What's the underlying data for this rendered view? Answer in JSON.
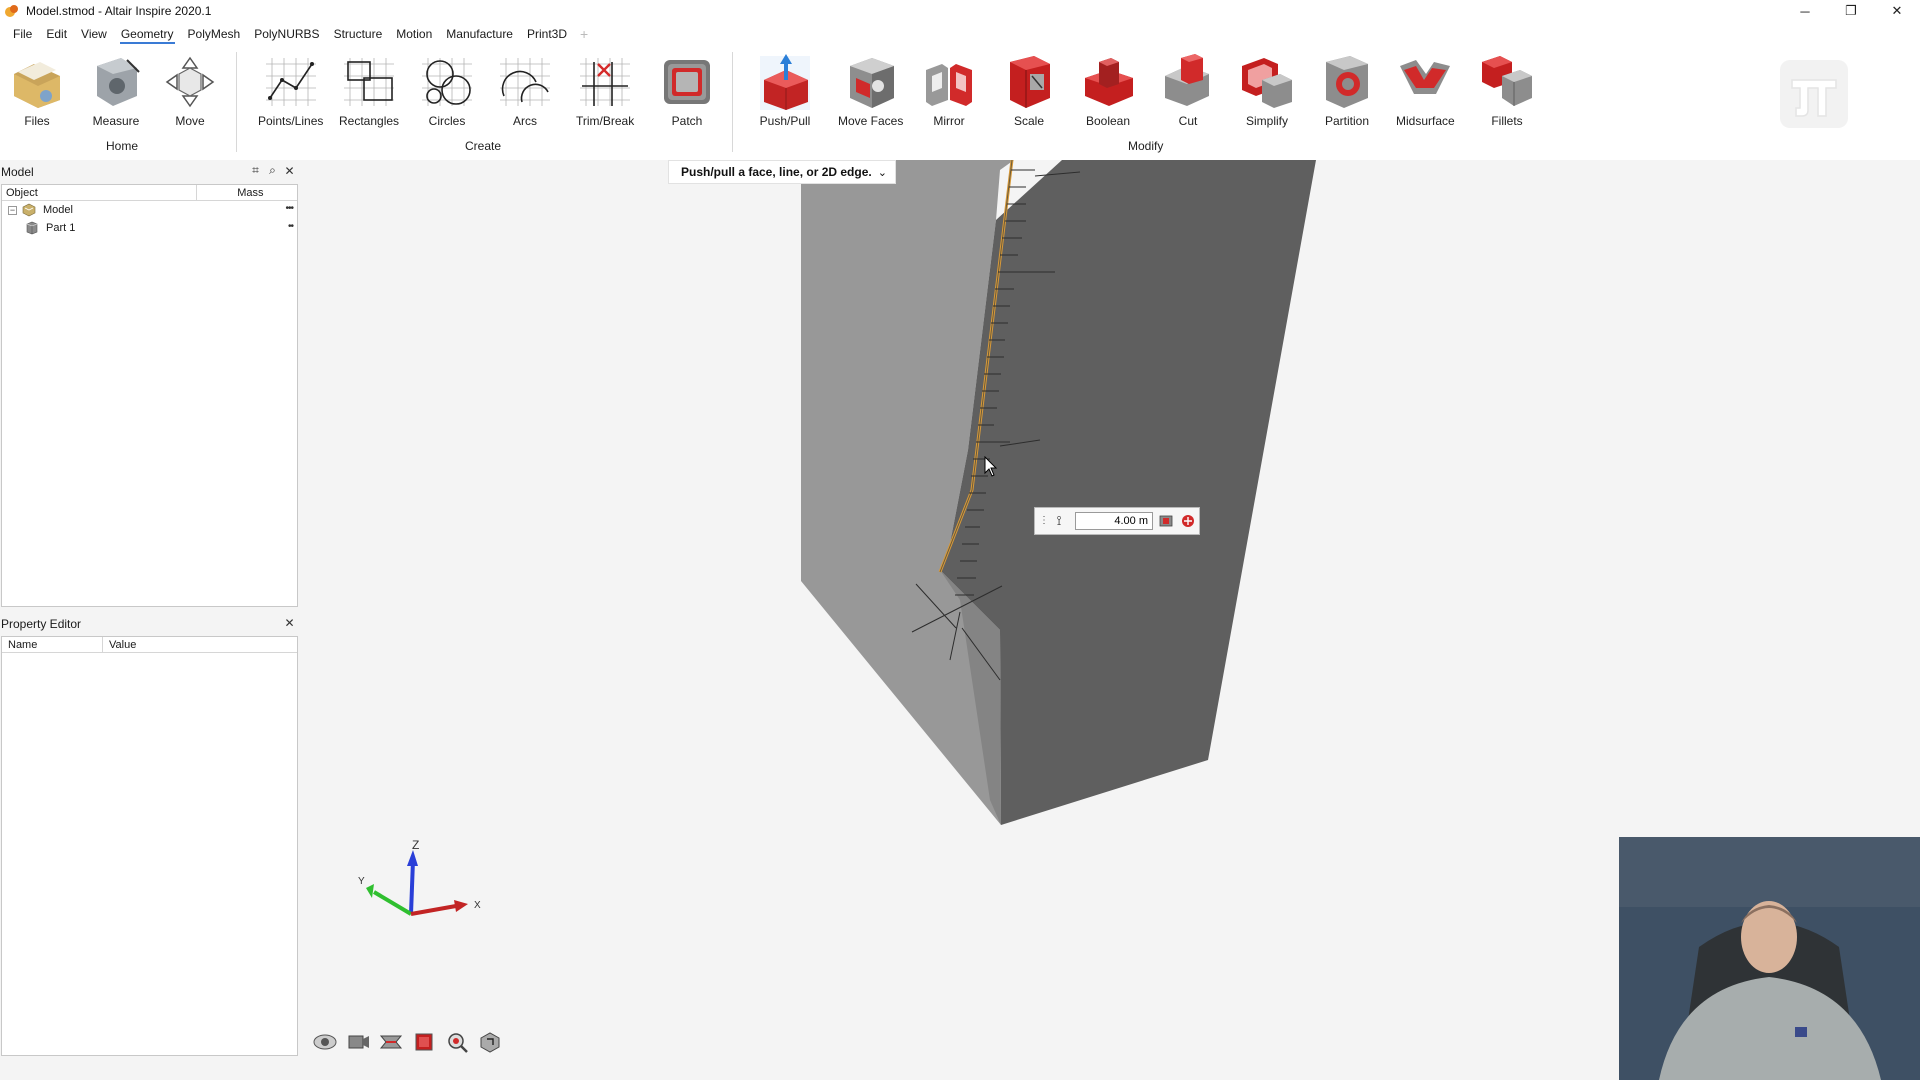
{
  "window": {
    "title": "Model.stmod - Altair Inspire 2020.1",
    "controls": {
      "minimize": "─",
      "restore": "❐",
      "close": "✕"
    }
  },
  "menu": {
    "items": [
      {
        "label": "File"
      },
      {
        "label": "Edit"
      },
      {
        "label": "View"
      },
      {
        "label": "Geometry",
        "active": true
      },
      {
        "label": "PolyMesh"
      },
      {
        "label": "PolyNURBS"
      },
      {
        "label": "Structure"
      },
      {
        "label": "Motion"
      },
      {
        "label": "Manufacture"
      },
      {
        "label": "Print3D"
      }
    ],
    "add_tab": "+"
  },
  "ribbon": {
    "tools": {
      "files": "Files",
      "measure": "Measure",
      "move": "Move",
      "points_lines": "Points/Lines",
      "rectangles": "Rectangles",
      "circles": "Circles",
      "arcs": "Arcs",
      "trim_break": "Trim/Break",
      "patch": "Patch",
      "push_pull": "Push/Pull",
      "move_faces": "Move Faces",
      "mirror": "Mirror",
      "scale": "Scale",
      "boolean": "Boolean",
      "cut": "Cut",
      "simplify": "Simplify",
      "partition": "Partition",
      "midsurface": "Midsurface",
      "fillets": "Fillets"
    },
    "groups": {
      "home": "Home",
      "create": "Create",
      "modify": "Modify"
    }
  },
  "model_browser": {
    "title": "Model",
    "columns": {
      "object": "Object",
      "mass": "Mass"
    },
    "rows": [
      {
        "label": "Model",
        "dots": "•••",
        "expander": "−"
      },
      {
        "label": "Part 1",
        "dots": "••"
      }
    ]
  },
  "property_editor": {
    "title": "Property Editor",
    "columns": {
      "name": "Name",
      "value": "Value"
    }
  },
  "viewport": {
    "prompt": "Push/pull a face, line, or 2D edge.",
    "prompt_chevron": "⌄",
    "distance_value": "4.00 m",
    "measure_icon": "⟟",
    "grip": "⋮",
    "triad_labels": {
      "z": "Z",
      "y": "Y",
      "x": "X"
    }
  },
  "colors": {
    "accent": "#3a7bd5",
    "face_light": "#979797",
    "face_dark": "#606060",
    "edge_highlight": "#d89a3a"
  }
}
